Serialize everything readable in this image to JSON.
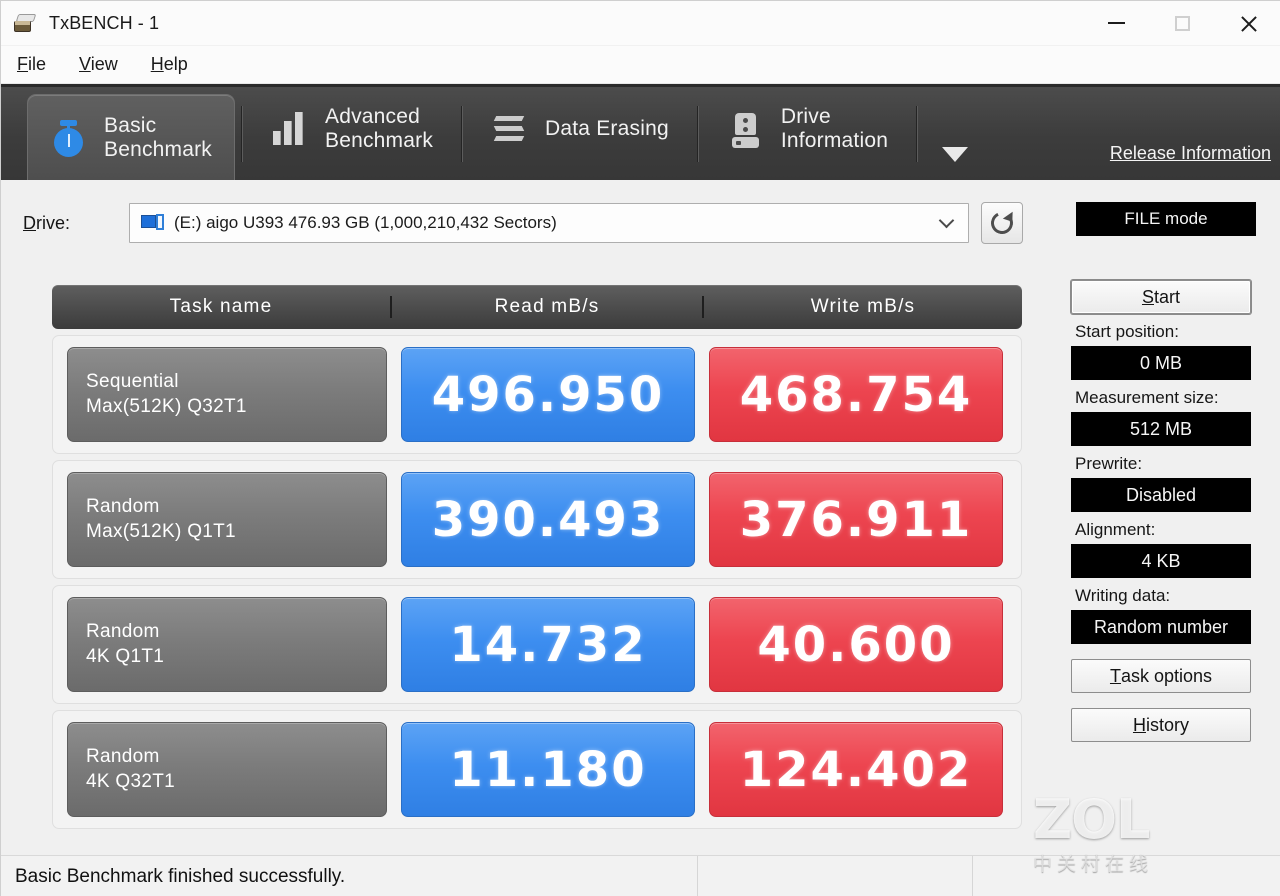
{
  "window": {
    "title": "TxBENCH - 1",
    "icon": "drive-icon",
    "minimize_label": "Minimize",
    "maximize_label": "Maximize",
    "close_label": "Close"
  },
  "menu": {
    "items": [
      {
        "accel": "F",
        "rest": "ile"
      },
      {
        "accel": "V",
        "rest": "iew"
      },
      {
        "accel": "H",
        "rest": "elp"
      }
    ]
  },
  "tabs": {
    "items": [
      {
        "line1": "Basic",
        "line2": "Benchmark",
        "icon": "stopwatch-icon",
        "active": true
      },
      {
        "line1": "Advanced",
        "line2": "Benchmark",
        "icon": "bar-chart-icon",
        "active": false
      },
      {
        "line1": "Data Erasing",
        "line2": "",
        "icon": "eraser-icon",
        "active": false
      },
      {
        "line1": "Drive",
        "line2": "Information",
        "icon": "drive-info-icon",
        "active": false
      }
    ],
    "more_icon": "chevron-down-icon",
    "release_link": "Release Information"
  },
  "drive": {
    "label_accel": "D",
    "label_rest": "rive:",
    "selected": "(E:) aigo U393  476.93 GB (1,000,210,432 Sectors)",
    "dropdown_icon": "chevron-down-icon",
    "refresh_icon": "refresh-icon",
    "mode_button": "FILE mode"
  },
  "table": {
    "headers": [
      "Task name",
      "Read mB/s",
      "Write mB/s"
    ],
    "rows": [
      {
        "task_line1": "Sequential",
        "task_line2": "Max(512K) Q32T1",
        "read": "496.950",
        "write": "468.754"
      },
      {
        "task_line1": "Random",
        "task_line2": "Max(512K) Q1T1",
        "read": "390.493",
        "write": "376.911"
      },
      {
        "task_line1": "Random",
        "task_line2": "4K Q1T1",
        "read": "14.732",
        "write": "40.600"
      },
      {
        "task_line1": "Random",
        "task_line2": "4K Q32T1",
        "read": "11.180",
        "write": "124.402"
      }
    ]
  },
  "sidebar": {
    "start_accel": "S",
    "start_rest": "tart",
    "start_position_label": "Start position:",
    "start_position_value": "0 MB",
    "measurement_size_label": "Measurement size:",
    "measurement_size_value": "512 MB",
    "prewrite_label": "Prewrite:",
    "prewrite_value": "Disabled",
    "alignment_label": "Alignment:",
    "alignment_value": "4 KB",
    "writing_data_label": "Writing data:",
    "writing_data_value": "Random number",
    "task_options_accel": "T",
    "task_options_rest": "ask options",
    "history_accel": "H",
    "history_rest": "istory"
  },
  "status": {
    "message": "Basic Benchmark finished successfully."
  },
  "watermark": {
    "text": "ZOL",
    "subtext": "中关村在线"
  },
  "colors": {
    "read_accent": "#3d8ef0",
    "write_accent": "#ed4550",
    "toolbar_bg": "#3c3c3c",
    "active_tab_bg": "#555555",
    "task_cell_bg": "#7c7c7c",
    "value_dark": "#000000",
    "window_bg": "#f0f0f0"
  }
}
